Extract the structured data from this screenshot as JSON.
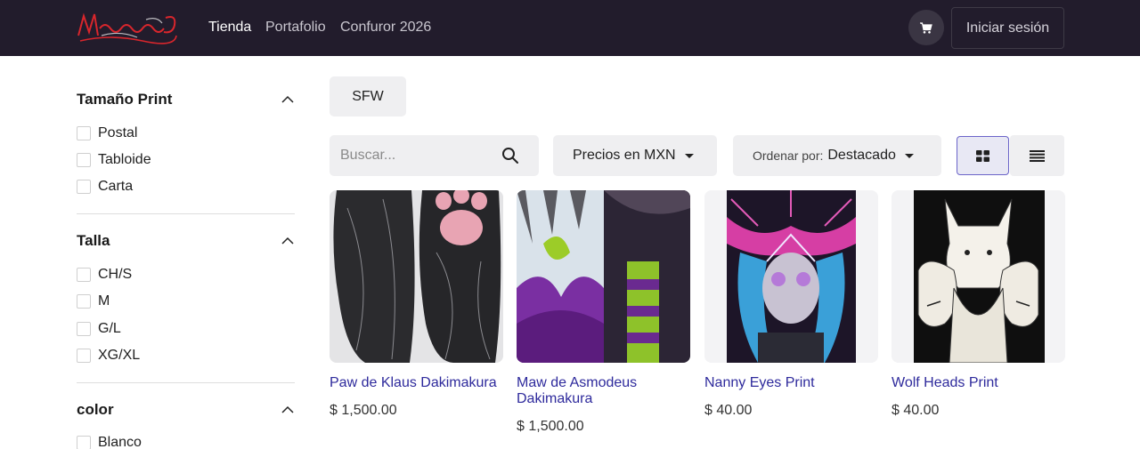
{
  "navbar": {
    "logo_text": "Mr.Sysnaud",
    "links": [
      {
        "label": "Tienda",
        "active": true
      },
      {
        "label": "Portafolio",
        "active": false
      },
      {
        "label": "Confuror 2026",
        "active": false
      }
    ],
    "cart_icon": "cart-icon",
    "login_label": "Iniciar sesión"
  },
  "sidebar": {
    "filters": [
      {
        "title": "Tamaño Print",
        "options": [
          "Postal",
          "Tabloide",
          "Carta"
        ]
      },
      {
        "title": "Talla",
        "options": [
          "CH/S",
          "M",
          "G/L",
          "XG/XL"
        ]
      },
      {
        "title": "color",
        "options": [
          "Blanco"
        ]
      }
    ]
  },
  "main": {
    "tag": "SFW",
    "search": {
      "placeholder": "Buscar...",
      "value": ""
    },
    "currency_dropdown": "Precios en MXN",
    "sort": {
      "prefix": "Ordenar por:",
      "value": "Destacado"
    },
    "view_modes": [
      "grid",
      "list"
    ],
    "active_view": "grid",
    "products": [
      {
        "title": "Paw de Klaus Dakimakura",
        "price": "$ 1,500.00"
      },
      {
        "title": "Maw de Asmodeus Dakimakura",
        "price": "$ 1,500.00"
      },
      {
        "title": "Nanny Eyes Print",
        "price": "$ 40.00"
      },
      {
        "title": "Wolf Heads Print",
        "price": "$ 40.00"
      }
    ]
  },
  "colors": {
    "navbar_bg": "#221c2c",
    "product_link": "#2e2a9c",
    "active_view_border": "#6b64c9"
  }
}
